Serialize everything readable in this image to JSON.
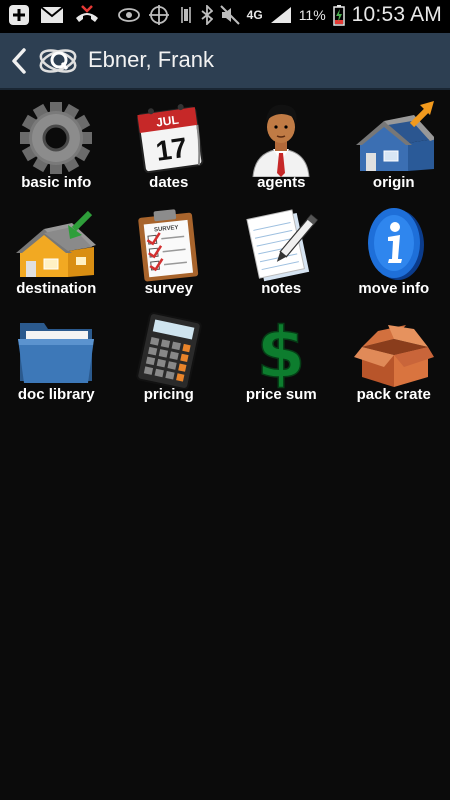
{
  "status_bar": {
    "network": "4G",
    "battery": "11%",
    "time": "10:53 AM"
  },
  "header": {
    "title": "Ebner, Frank"
  },
  "tiles": [
    {
      "label": "basic info",
      "icon": "gear-icon"
    },
    {
      "label": "dates",
      "icon": "calendar-icon",
      "calendar_month": "JUL",
      "calendar_day": "17"
    },
    {
      "label": "agents",
      "icon": "agent-icon"
    },
    {
      "label": "origin",
      "icon": "house-origin-icon"
    },
    {
      "label": "destination",
      "icon": "house-destination-icon"
    },
    {
      "label": "survey",
      "icon": "clipboard-icon",
      "clipboard_text": "SURVEY"
    },
    {
      "label": "notes",
      "icon": "notepad-icon"
    },
    {
      "label": "move info",
      "icon": "info-icon"
    },
    {
      "label": "doc library",
      "icon": "folder-icon"
    },
    {
      "label": "pricing",
      "icon": "calculator-icon"
    },
    {
      "label": "price sum",
      "icon": "dollar-icon"
    },
    {
      "label": "pack crate",
      "icon": "box-icon"
    }
  ]
}
